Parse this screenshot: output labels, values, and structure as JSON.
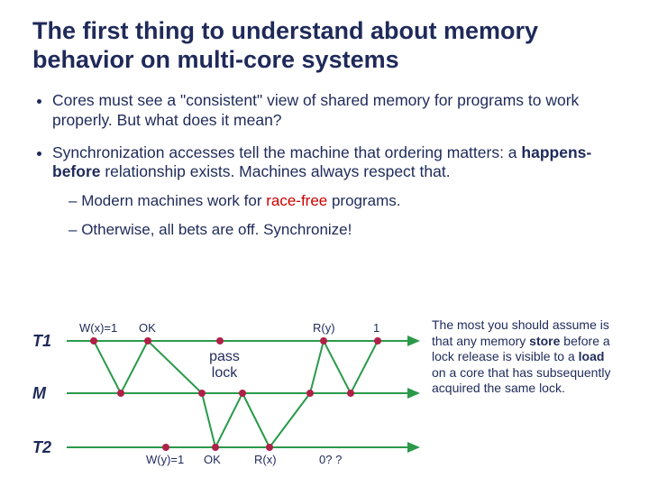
{
  "title": "The first thing to understand about memory behavior on multi-core systems",
  "bullets": {
    "b1": "Cores must see a \"consistent\" view of shared memory for programs to work properly.  But what does it mean?",
    "b2_pre": "Synchronization accesses tell the machine that ordering matters: a ",
    "b2_bold": "happens-before",
    "b2_post": " relationship exists.  Machines always respect that.",
    "s1_pre": "Modern machines work for ",
    "s1_red": "race-free",
    "s1_post": " programs.",
    "s2": "Otherwise, all bets are off.  Synchronize!"
  },
  "rows": {
    "t1": "T1",
    "m": "M",
    "t2": "T2"
  },
  "events": {
    "t1": {
      "wx": "W(x)=1",
      "ok": "OK",
      "ry": "R(y)",
      "one": "1"
    },
    "t2": {
      "wy": "W(y)=1",
      "ok": "OK",
      "rx": "R(x)",
      "zero": "0? ?"
    },
    "pass": "pass",
    "lock": "lock"
  },
  "note": {
    "n1": "The most you should assume is that any memory ",
    "n2": "store",
    "n3": " before a lock release is visible to a ",
    "n4": "load",
    "n5": " on a core that has subsequently acquired the same lock."
  }
}
